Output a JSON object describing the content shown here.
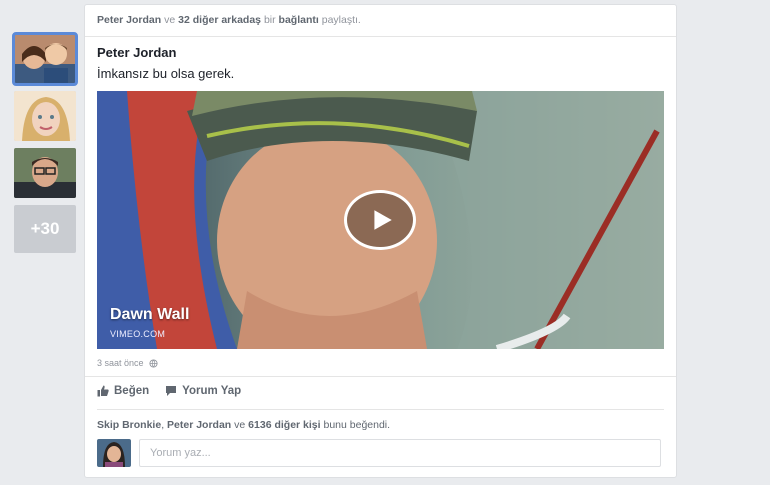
{
  "header": {
    "name1": "Peter Jordan",
    "conj1": "ve",
    "count_friends": "32 diğer arkadaş",
    "word_bir": "bir",
    "link_word": "bağlantı",
    "shared": "paylaştı."
  },
  "sidebar": {
    "more_count": "+30"
  },
  "post": {
    "author": "Peter Jordan",
    "text": "İmkansız bu olsa gerek.",
    "video_title": "Dawn Wall",
    "video_source": "VIMEO.COM",
    "timestamp": "3 saat önce"
  },
  "actions": {
    "like": "Beğen",
    "comment": "Yorum Yap"
  },
  "likes": {
    "name1": "Skip Bronkie",
    "sep": ",",
    "name2": "Peter Jordan",
    "conj": "ve",
    "others": "6136 diğer kişi",
    "suffix": "bunu beğendi."
  },
  "comment": {
    "placeholder": "Yorum yaz..."
  },
  "colors": {
    "selected_outline": "#5b8ad8",
    "text_secondary": "#90949c",
    "background": "#e9ebee"
  }
}
